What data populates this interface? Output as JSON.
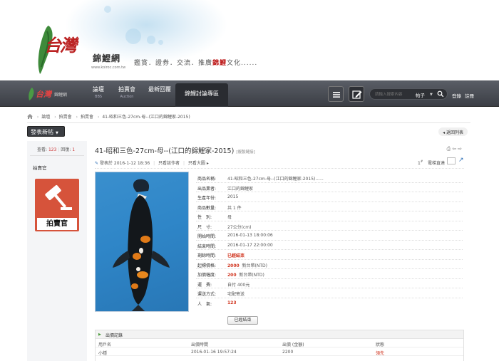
{
  "banner": {
    "logo_text": "台灣",
    "brand": "錦鯉網",
    "site_url": "www.koiroc.com.tw",
    "slogan_before": "鑑賞．證券．交流．推廣",
    "slogan_highlight": "錦鯉",
    "slogan_after": "文化......"
  },
  "nav": {
    "logo_text": "台灣",
    "logo_sub": "錦鯉網",
    "items": [
      {
        "label": "論壇",
        "sub": "BBS"
      },
      {
        "label": "拍賣會",
        "sub": "Auction"
      },
      {
        "label": "最新回覆",
        "sub": ""
      }
    ],
    "active_tab": "錦鯉討論專區",
    "search_placeholder": "請輸入搜索內容",
    "search_scope": "帖子",
    "login": "登錄",
    "register": "註冊"
  },
  "breadcrumb": [
    "論壇",
    "拍賣會",
    "拍賣會",
    "41-昭和三色-27cm-母--(江口的錦鯉家-2015)"
  ],
  "actions": {
    "post_button": "發表新帖",
    "back_button": "返回列表"
  },
  "sidebar": {
    "views_label": "查看:",
    "views": "123",
    "replies_label": "回復:",
    "replies": "1",
    "poster_name": "拍賣官",
    "badge_label": "拍賣官"
  },
  "post": {
    "title": "41-昭和三色-27cm-母--(江口的錦鯉家-2015)",
    "title_tag": "[複製鏈接]",
    "author_prefix": "發表於",
    "date": "2016-1-12 18:36",
    "author_only": "只看該作者",
    "view_image": "只看大圖",
    "floor_num": "1",
    "floor_suffix": "#",
    "goto_label": "電梯直達"
  },
  "auction": {
    "rows": [
      {
        "k": "商品名稱:",
        "v": "41-昭和三色-27cm-母--(江口的錦鯉家-2015)......"
      },
      {
        "k": "出品業者:",
        "v": "江口的錦鯉家"
      },
      {
        "k": "生產年份:",
        "v": "2015"
      },
      {
        "k": "商品數量:",
        "v": "共 1 件"
      },
      {
        "k": "性　別:",
        "v": "母"
      },
      {
        "k": "尺　寸:",
        "v": "27公分(cm)"
      },
      {
        "k": "開始時間:",
        "v": "2016-01-13 18:00:06"
      },
      {
        "k": "結束時間:",
        "v": "2016-01-17 22:00:00"
      },
      {
        "k": "剩餘時間:",
        "v": "已經結束"
      },
      {
        "k": "起標價格:",
        "v_num": "2000",
        "v_unit": "新台幣(NTD)"
      },
      {
        "k": "加價幅度:",
        "v_num": "200",
        "v_unit": "新台幣(NTD)"
      },
      {
        "k": "運　費:",
        "v": "自付 400元"
      },
      {
        "k": "運送方式:",
        "v": "宅配寄送"
      },
      {
        "k": "人　氣:",
        "v": "123"
      }
    ],
    "ended_button": "已經結束"
  },
  "bids": {
    "title": "出價記錄",
    "columns": [
      "用戶名",
      "出價時間",
      "出價 (金額)",
      "狀態"
    ],
    "rows": [
      {
        "user": "小穩",
        "time": "2016-01-16 19:57:24",
        "amount": "2200",
        "status": "領先"
      }
    ]
  },
  "colors": {
    "accent_red": "#d0331d",
    "nav_bg": "#474a51",
    "badge_bg": "#d6533b"
  }
}
